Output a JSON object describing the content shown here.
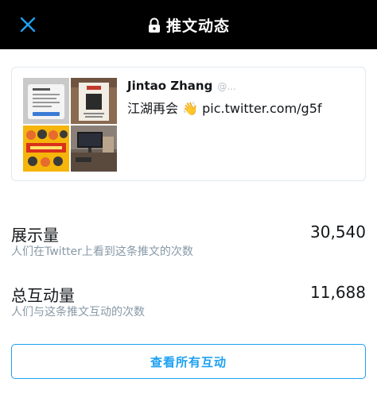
{
  "header": {
    "title": "推文动态",
    "close_icon": "close-icon",
    "lock_icon": "lock-icon",
    "accent_color": "#1da1f2"
  },
  "tweet": {
    "author": "Jintao Zhang",
    "handle": "@...",
    "text": "江湖再会 👋 ",
    "link": "pic.twitter.com/g5f",
    "images": [
      "photo-screenshot",
      "photo-poster",
      "photo-event-banner",
      "photo-desk-monitor"
    ]
  },
  "stats": [
    {
      "label": "展示量",
      "value": "30,540",
      "description": "人们在Twitter上看到这条推文的次数"
    },
    {
      "label": "总互动量",
      "value": "11,688",
      "description": "人们与这条推文互动的次数"
    }
  ],
  "actions": {
    "view_all": "查看所有互动"
  }
}
